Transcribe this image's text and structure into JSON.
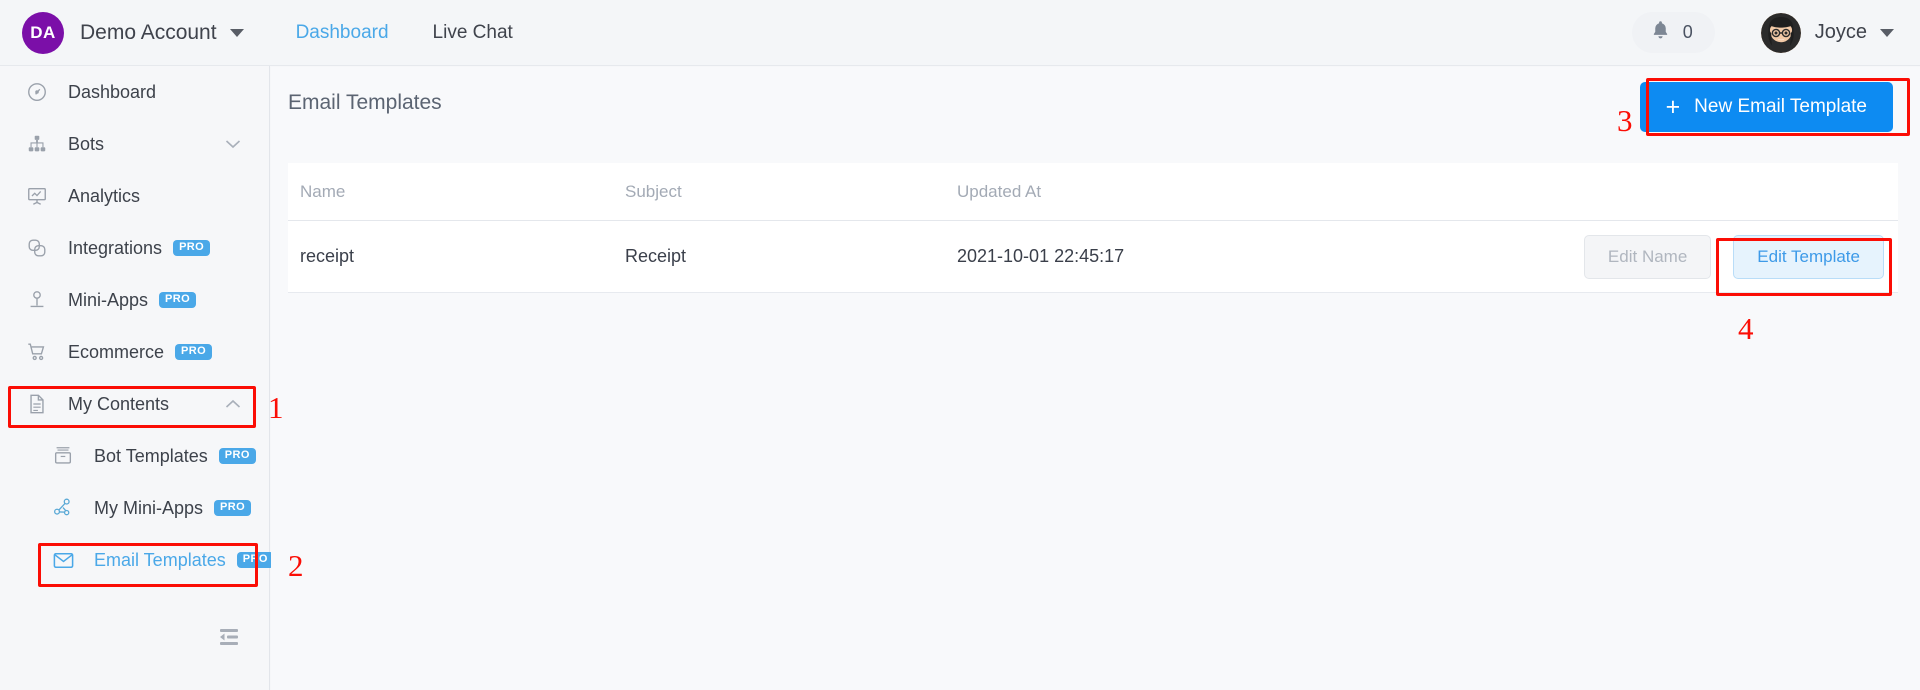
{
  "topbar": {
    "account_initials": "DA",
    "account_name": "Demo Account",
    "account_caret_icon": "chevron-down-icon",
    "nav": [
      {
        "label": "Dashboard",
        "active": true
      },
      {
        "label": "Live Chat",
        "active": false
      }
    ],
    "notification_icon": "bell-icon",
    "notification_count": "0",
    "user_name": "Joyce",
    "user_caret_icon": "chevron-down-icon",
    "avatar_icon": "user-avatar"
  },
  "sidebar": {
    "items": [
      {
        "label": "Dashboard",
        "icon": "dashboard-icon",
        "pro": false,
        "sub": false,
        "chevron": "",
        "active": false
      },
      {
        "label": "Bots",
        "icon": "sitemap-icon",
        "pro": false,
        "sub": false,
        "chevron": "down",
        "active": false
      },
      {
        "label": "Analytics",
        "icon": "analytics-icon",
        "pro": false,
        "sub": false,
        "chevron": "",
        "active": false
      },
      {
        "label": "Integrations",
        "icon": "integrations-icon",
        "pro": true,
        "sub": false,
        "chevron": "",
        "active": false
      },
      {
        "label": "Mini-Apps",
        "icon": "mini-apps-icon",
        "pro": true,
        "sub": false,
        "chevron": "",
        "active": false
      },
      {
        "label": "Ecommerce",
        "icon": "cart-icon",
        "pro": true,
        "sub": false,
        "chevron": "",
        "active": false
      },
      {
        "label": "My Contents",
        "icon": "document-icon",
        "pro": false,
        "sub": false,
        "chevron": "up",
        "active": false
      },
      {
        "label": "Bot Templates",
        "icon": "box-icon",
        "pro": true,
        "sub": true,
        "chevron": "",
        "active": false
      },
      {
        "label": "My Mini-Apps",
        "icon": "node-icon",
        "pro": true,
        "sub": true,
        "chevron": "",
        "active": false
      },
      {
        "label": "Email Templates",
        "icon": "envelope-icon",
        "pro": true,
        "sub": true,
        "chevron": "",
        "active": true
      }
    ],
    "pro_badge_label": "PRO",
    "collapse_icon": "menu-fold-icon"
  },
  "main": {
    "page_title": "Email Templates",
    "new_template_button": {
      "label": "New Email Template",
      "plus_icon": "plus-icon"
    },
    "table": {
      "columns": [
        "Name",
        "Subject",
        "Updated At"
      ],
      "rows": [
        {
          "name": "receipt",
          "subject": "Receipt",
          "updated_at": "2021-10-01 22:45:17",
          "edit_name_label": "Edit Name",
          "edit_template_label": "Edit Template"
        }
      ]
    }
  },
  "annotations": {
    "markers": [
      "1",
      "2",
      "3",
      "4"
    ]
  },
  "colors": {
    "accent_blue": "#0d8bf2",
    "link_blue": "#4aa8e8",
    "annotation_red": "#fb0d05",
    "account_purple": "#7b0fa8",
    "page_bg": "#f6f7f9",
    "card_bg": "#ffffff"
  }
}
